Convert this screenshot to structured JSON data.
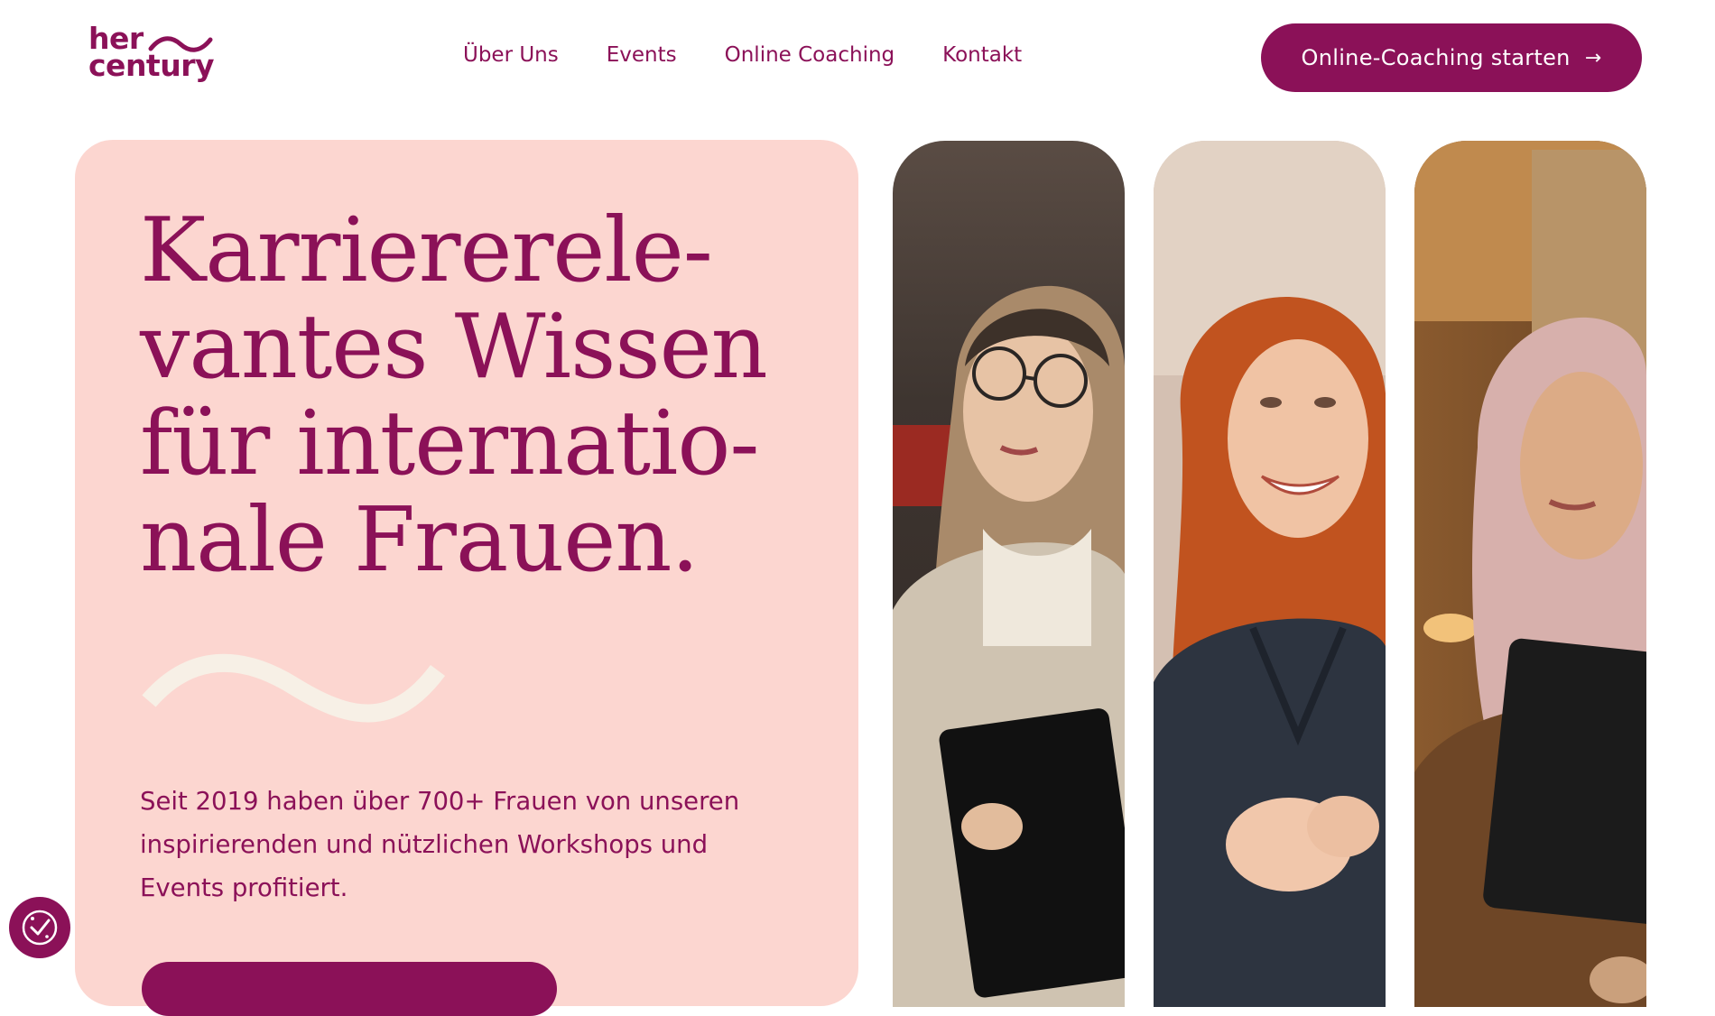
{
  "brand": {
    "line1": "her",
    "line2": "century",
    "color": "#8b1158"
  },
  "nav": {
    "items": [
      {
        "label": "Über Uns"
      },
      {
        "label": "Events"
      },
      {
        "label": "Online Coaching"
      },
      {
        "label": "Kontakt"
      }
    ]
  },
  "header": {
    "cta_label": "Online-Coaching starten",
    "cta_icon": "arrow-right-icon"
  },
  "hero": {
    "headline_lines": [
      "Karrierere­le-",
      "vantes Wissen",
      "für internatio-",
      "nale Frauen."
    ],
    "lead_lines": [
      "Seit 2019 haben über 700+ Frauen von unseren",
      "inspirierenden und nützlichen Workshops und",
      "Events profitiert."
    ],
    "background": "#fcd6d0",
    "accent": "#8b1158",
    "wave_color": "#f7f0e6"
  },
  "photos": [
    {
      "icon": "woman-with-glasses-laptop-photo"
    },
    {
      "icon": "smiling-redhead-woman-photo"
    },
    {
      "icon": "woman-in-hijab-with-tablet-photo"
    }
  ],
  "consent": {
    "icon": "cookie-consent-icon"
  }
}
